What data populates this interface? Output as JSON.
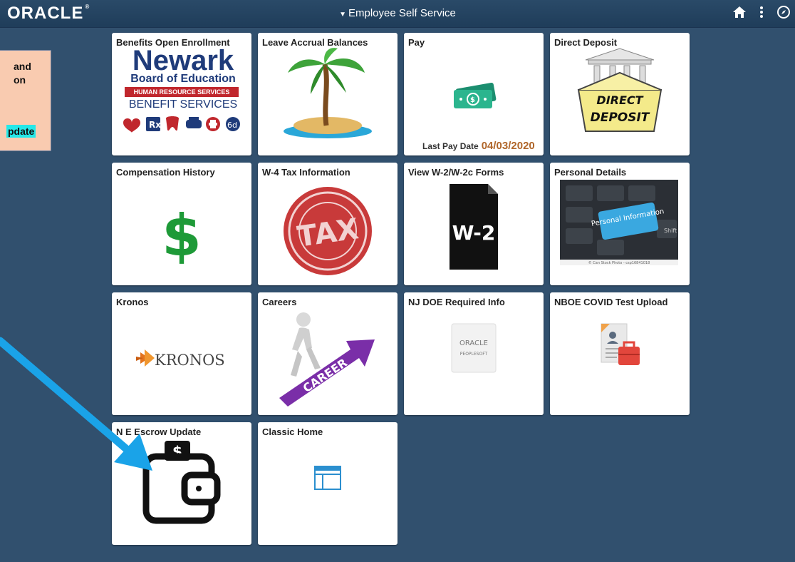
{
  "header": {
    "logo": "ORACLE",
    "title": "Employee Self Service"
  },
  "note": {
    "line1": "and",
    "line2": "on",
    "line3": "pdate"
  },
  "tiles": [
    {
      "title": "Benefits Open Enrollment",
      "newark": "Newark",
      "board": "Board of Education",
      "hr": "HUMAN RESOURCE SERVICES",
      "benefit": "BENEFIT SERVICES"
    },
    {
      "title": "Leave Accrual Balances"
    },
    {
      "title": "Pay",
      "last_pay_label": "Last Pay Date",
      "last_pay_value": "04/03/2020"
    },
    {
      "title": "Direct Deposit",
      "line1": "DIRECT",
      "line2": "DEPOSIT"
    },
    {
      "title": "Compensation History"
    },
    {
      "title": "W-4 Tax Information",
      "stamp": "TAX"
    },
    {
      "title": "View W-2/W-2c Forms",
      "doc": "W-2"
    },
    {
      "title": "Personal Details",
      "key": "Personal Information",
      "shift": "Shift",
      "credit": "© Can Stock Photo - csp16841018"
    },
    {
      "title": "Kronos",
      "brand": "KRONOS"
    },
    {
      "title": "Careers",
      "arrow": "CAREER"
    },
    {
      "title": "NJ DOE Required Info",
      "oracle": "ORACLE",
      "people": "PEOPLESOFT"
    },
    {
      "title": "NBOE COVID Test Upload"
    },
    {
      "title": "N  E Escrow Update"
    },
    {
      "title": "Classic Home"
    }
  ],
  "colors": {
    "background": "#31506e",
    "tile": "#ffffff",
    "annotation_arrow": "#1aa3e8",
    "note_bg": "#f9cbb0",
    "highlight": "#24e8e8"
  }
}
